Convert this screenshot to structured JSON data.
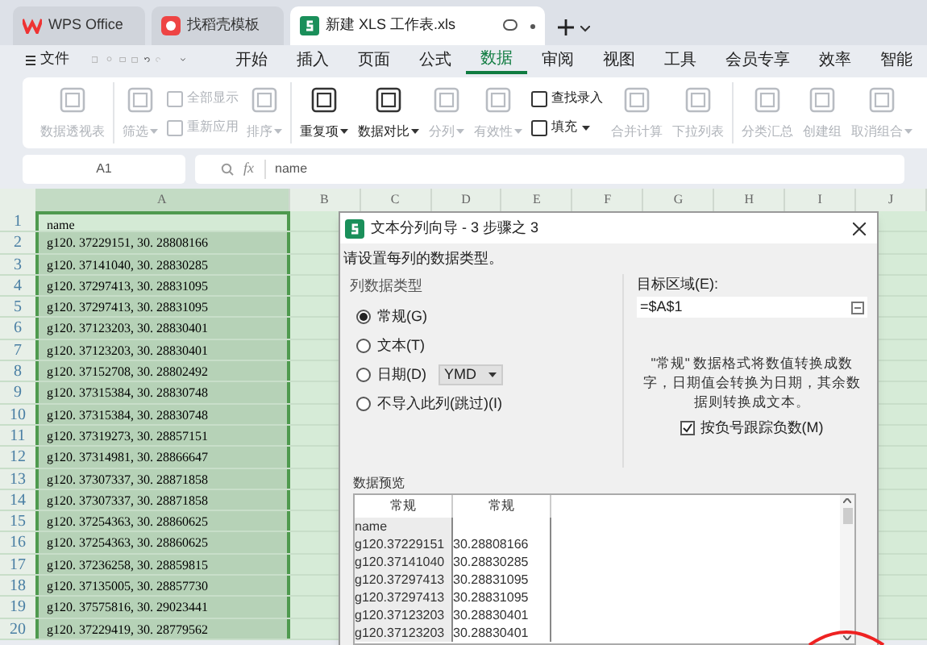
{
  "tabs": [
    {
      "label": "WPS Office",
      "kind": "wps",
      "selected": false
    },
    {
      "label": "找稻壳模板",
      "kind": "docer",
      "selected": false
    },
    {
      "label": "新建 XLS 工作表.xls",
      "kind": "sheet",
      "selected": true
    }
  ],
  "menu": {
    "file": "文件",
    "items": [
      {
        "label": "开始",
        "selected": false
      },
      {
        "label": "插入",
        "selected": false
      },
      {
        "label": "页面",
        "selected": false
      },
      {
        "label": "公式",
        "selected": false
      },
      {
        "label": "数据",
        "selected": true
      },
      {
        "label": "审阅",
        "selected": false
      },
      {
        "label": "视图",
        "selected": false
      },
      {
        "label": "工具",
        "selected": false
      },
      {
        "label": "会员专享",
        "selected": false
      },
      {
        "label": "效率",
        "selected": false
      },
      {
        "label": "智能",
        "selected": false
      }
    ]
  },
  "ribbon": [
    [
      {
        "kind": "big",
        "label": "数据透视表",
        "disabled": true
      }
    ],
    [
      {
        "kind": "big",
        "label": "筛选",
        "disabled": true,
        "dropdown": true
      },
      {
        "kind": "pair",
        "items": [
          {
            "label": "全部显示",
            "disabled": true
          },
          {
            "label": "重新应用",
            "disabled": true
          }
        ]
      },
      {
        "kind": "big",
        "label": "排序",
        "disabled": true,
        "dropdown": true
      }
    ],
    [
      {
        "kind": "big",
        "label": "重复项",
        "disabled": false,
        "dropdown": true
      },
      {
        "kind": "big",
        "label": "数据对比",
        "disabled": false,
        "dropdown": true
      },
      {
        "kind": "big",
        "label": "分列",
        "disabled": true,
        "dropdown": true
      },
      {
        "kind": "big",
        "label": "有效性",
        "disabled": true,
        "dropdown": true
      },
      {
        "kind": "pair",
        "items": [
          {
            "label": "查找录入",
            "disabled": false
          },
          {
            "label": "填充",
            "disabled": false,
            "dropdown": true
          }
        ]
      },
      {
        "kind": "big",
        "label": "合并计算",
        "disabled": true
      },
      {
        "kind": "big",
        "label": "下拉列表",
        "disabled": true
      }
    ],
    [
      {
        "kind": "big",
        "label": "分类汇总",
        "disabled": true
      },
      {
        "kind": "big",
        "label": "创建组",
        "disabled": true
      },
      {
        "kind": "big",
        "label": "取消组合",
        "disabled": true,
        "dropdown": true
      }
    ]
  ],
  "cell_ref": "A1",
  "fx_label": "fx",
  "formula": "name",
  "columns": [
    "A",
    "B",
    "C",
    "D",
    "E",
    "F",
    "G",
    "H",
    "I",
    "J"
  ],
  "rows": [
    {
      "number": "1",
      "value": "name"
    },
    {
      "number": "2",
      "value": "g120. 37229151, 30. 28808166"
    },
    {
      "number": "3",
      "value": "g120. 37141040, 30. 28830285"
    },
    {
      "number": "4",
      "value": "g120. 37297413, 30. 28831095"
    },
    {
      "number": "5",
      "value": "g120. 37297413, 30. 28831095"
    },
    {
      "number": "6",
      "value": "g120. 37123203, 30. 28830401"
    },
    {
      "number": "7",
      "value": "g120. 37123203, 30. 28830401"
    },
    {
      "number": "8",
      "value": "g120. 37152708, 30. 28802492"
    },
    {
      "number": "9",
      "value": "g120. 37315384, 30. 28830748"
    },
    {
      "number": "10",
      "value": "g120. 37315384, 30. 28830748"
    },
    {
      "number": "11",
      "value": "g120. 37319273, 30. 28857151"
    },
    {
      "number": "12",
      "value": "g120. 37314981, 30. 28866647"
    },
    {
      "number": "13",
      "value": "g120. 37307337, 30. 28871858"
    },
    {
      "number": "14",
      "value": "g120. 37307337, 30. 28871858"
    },
    {
      "number": "15",
      "value": "g120. 37254363, 30. 28860625"
    },
    {
      "number": "16",
      "value": "g120. 37254363, 30. 28860625"
    },
    {
      "number": "17",
      "value": "g120. 37236258, 30. 28859815"
    },
    {
      "number": "18",
      "value": "g120. 37135005, 30. 28857730"
    },
    {
      "number": "19",
      "value": "g120. 37575816, 30. 29023441"
    },
    {
      "number": "20",
      "value": "g120. 37229419, 30. 28779562"
    }
  ],
  "dialog": {
    "title": "文本分列向导 - 3 步骤之 3",
    "prompt": "请设置每列的数据类型。",
    "group_title": "列数据类型",
    "options": [
      {
        "label": "常规(G)",
        "selected": true
      },
      {
        "label": "文本(T)",
        "selected": false
      },
      {
        "label": "日期(D)",
        "selected": false,
        "date_format": "YMD"
      },
      {
        "label": "不导入此列(跳过)(I)",
        "selected": false
      }
    ],
    "target_label": "目标区域(E):",
    "target_value": "=$A$1",
    "note": "\"常规\" 数据格式将数值转换成数字，日期值会转换为日期，其余数据则转换成文本。",
    "negative": {
      "label": "按负号跟踪负数(M)",
      "checked": true
    },
    "preview_title": "数据预览",
    "preview_headers": [
      "常规",
      "常规"
    ],
    "preview_rows": [
      [
        "name",
        ""
      ],
      [
        "g120.37229151",
        "30.28808166"
      ],
      [
        "g120.37141040",
        "30.28830285"
      ],
      [
        "g120.37297413",
        "30.28831095"
      ],
      [
        "g120.37297413",
        "30.28831095"
      ],
      [
        "g120.37123203",
        "30.28830401"
      ],
      [
        "g120.37123203",
        "30.28830401"
      ]
    ]
  }
}
